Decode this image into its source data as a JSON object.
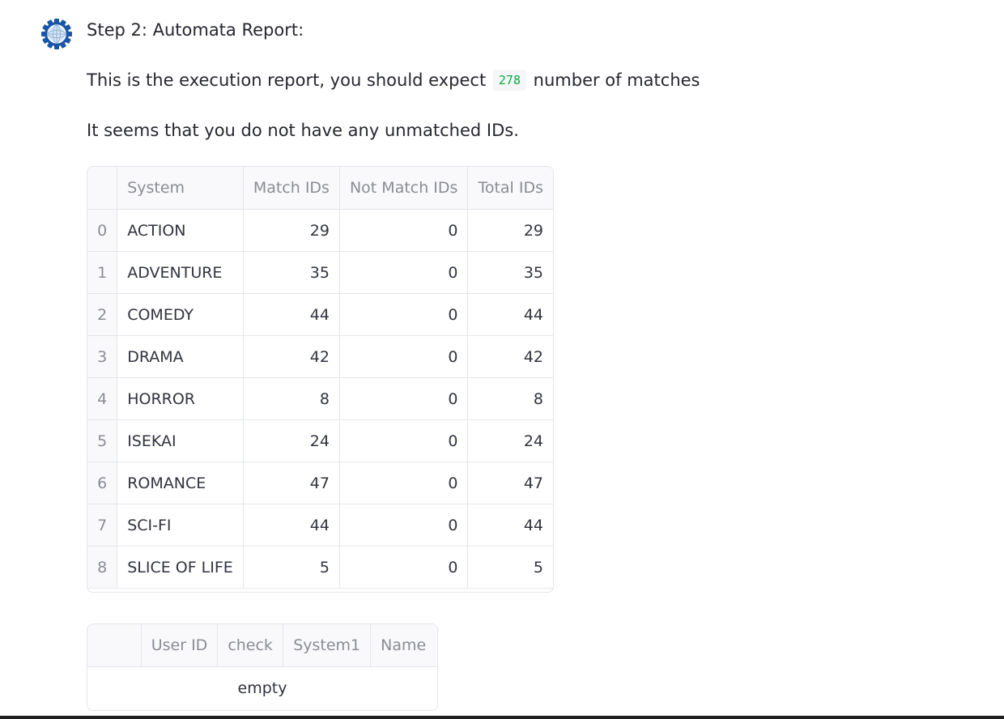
{
  "message": {
    "heading": "Step 2: Automata Report:",
    "report_prefix": "This is the execution report, you should expect",
    "expected_matches": "278",
    "report_suffix": "number of matches",
    "unmatched_note": "It seems that you do not have any unmatched IDs."
  },
  "avatar": {
    "icon": "gear-globe-icon",
    "colors": {
      "gear": "#1a56a8",
      "globe": "#d9e6f5"
    }
  },
  "report_table": {
    "columns": [
      "",
      "System",
      "Match IDs",
      "Not Match IDs",
      "Total IDs"
    ],
    "rows": [
      {
        "index": "0",
        "system": "ACTION",
        "match": "29",
        "not_match": "0",
        "total": "29"
      },
      {
        "index": "1",
        "system": "ADVENTURE",
        "match": "35",
        "not_match": "0",
        "total": "35"
      },
      {
        "index": "2",
        "system": "COMEDY",
        "match": "44",
        "not_match": "0",
        "total": "44"
      },
      {
        "index": "3",
        "system": "DRAMA",
        "match": "42",
        "not_match": "0",
        "total": "42"
      },
      {
        "index": "4",
        "system": "HORROR",
        "match": "8",
        "not_match": "0",
        "total": "8"
      },
      {
        "index": "5",
        "system": "ISEKAI",
        "match": "24",
        "not_match": "0",
        "total": "24"
      },
      {
        "index": "6",
        "system": "ROMANCE",
        "match": "47",
        "not_match": "0",
        "total": "47"
      },
      {
        "index": "7",
        "system": "SCI-FI",
        "match": "44",
        "not_match": "0",
        "total": "44"
      },
      {
        "index": "8",
        "system": "SLICE OF LIFE",
        "match": "5",
        "not_match": "0",
        "total": "5"
      }
    ]
  },
  "unmatched_table": {
    "columns": [
      "",
      "User ID",
      "check",
      "System1",
      "Name"
    ],
    "empty_label": "empty"
  },
  "colors": {
    "code_text": "#09ab3b",
    "border": "#e4e6ec",
    "header_bg": "#f9f9fb"
  }
}
